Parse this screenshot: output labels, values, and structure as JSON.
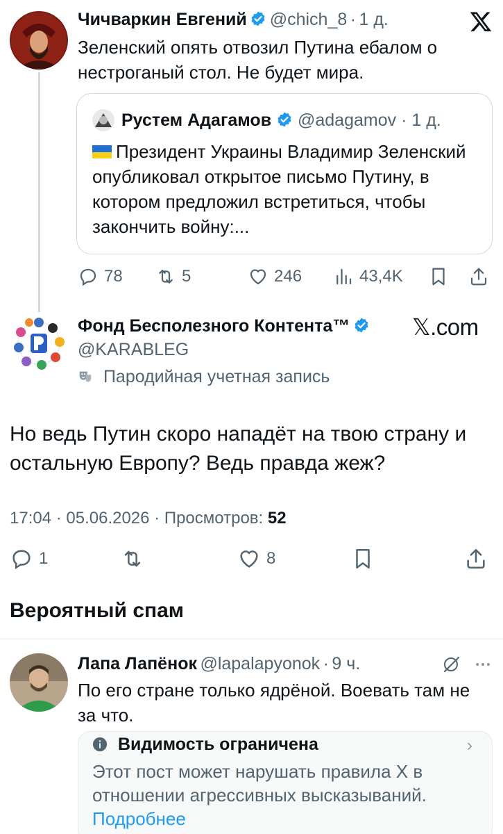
{
  "colors": {
    "verified": "#1d9bf0",
    "text": "#0f1419",
    "muted": "#536471",
    "link": "#1d9bf0",
    "border": "#cfd9de"
  },
  "tweet1": {
    "name": "Чичваркин Евгений",
    "handle": "@chich_8",
    "time": "1 д.",
    "text": "Зеленский опять отвозил Путина ебалом о нестроганый стол. Не будет мира.",
    "quote": {
      "name": "Рустем Адагамов",
      "handle": "@adagamov",
      "time": "1 д.",
      "text": "Президент Украины Владимир Зеленский опубликовал открытое письмо Путину, в котором предложил встретиться, чтобы закончить войну:..."
    },
    "actions": {
      "replies": "78",
      "reposts": "5",
      "likes": "246",
      "views": "43,4K"
    }
  },
  "tweet2": {
    "name": "Фонд Бесполезного Контента™",
    "handle": "@KARABLEG",
    "parody_label": "Пародийная учетная запись",
    "source_label": "𝕏.com",
    "text": "Но ведь Путин скоро нападёт на твою страну и остальную Европу? Ведь правда жеж?",
    "meta_prefix": "17:04 · 05.06.2026 · Просмотров:",
    "views": "52",
    "actions": {
      "replies": "1",
      "likes": "8"
    }
  },
  "spam_section": {
    "title": "Вероятный спам"
  },
  "reply": {
    "name": "Лапа Лапёнок",
    "handle": "@lapalapyonok",
    "time": "9 ч.",
    "text": "По его стране только ядрёной. Воевать там не за что.",
    "limited": {
      "title": "Видимость ограничена",
      "text": "Этот пост может нарушать правила X в отношении агрессивных высказываний.",
      "link": "Подробнее"
    }
  }
}
